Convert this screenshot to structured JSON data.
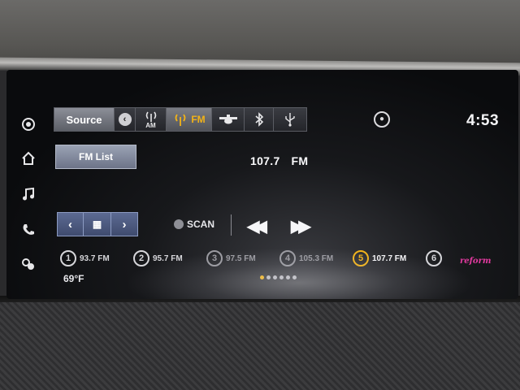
{
  "clock": "4:53",
  "source_tabs": {
    "source_label": "Source",
    "am_label": "AM",
    "fm_label": "FM"
  },
  "fm_list_label": "FM List",
  "now_playing": {
    "frequency": "107.7",
    "band": "FM"
  },
  "controls": {
    "scan_label": "SCAN"
  },
  "presets": [
    {
      "number": "1",
      "station": "93.7 FM"
    },
    {
      "number": "2",
      "station": "95.7 FM"
    },
    {
      "number": "3",
      "station": "97.5 FM"
    },
    {
      "number": "4",
      "station": "105.3 FM"
    },
    {
      "number": "5",
      "station": "107.7 FM"
    },
    {
      "number": "6",
      "station": ""
    }
  ],
  "station_logo_text": "reform",
  "outside_temp": "69°F",
  "colors": {
    "accent_active": "#f2b318",
    "tune_button": "#4a577e"
  },
  "icons": {
    "sidebar": [
      "camera-icon",
      "home-icon",
      "music-note-icon",
      "phone-icon",
      "apps-icon"
    ],
    "tabs": [
      "back-icon",
      "am-antenna-icon",
      "fm-antenna-icon",
      "satellite-icon",
      "bluetooth-icon",
      "usb-icon"
    ]
  }
}
